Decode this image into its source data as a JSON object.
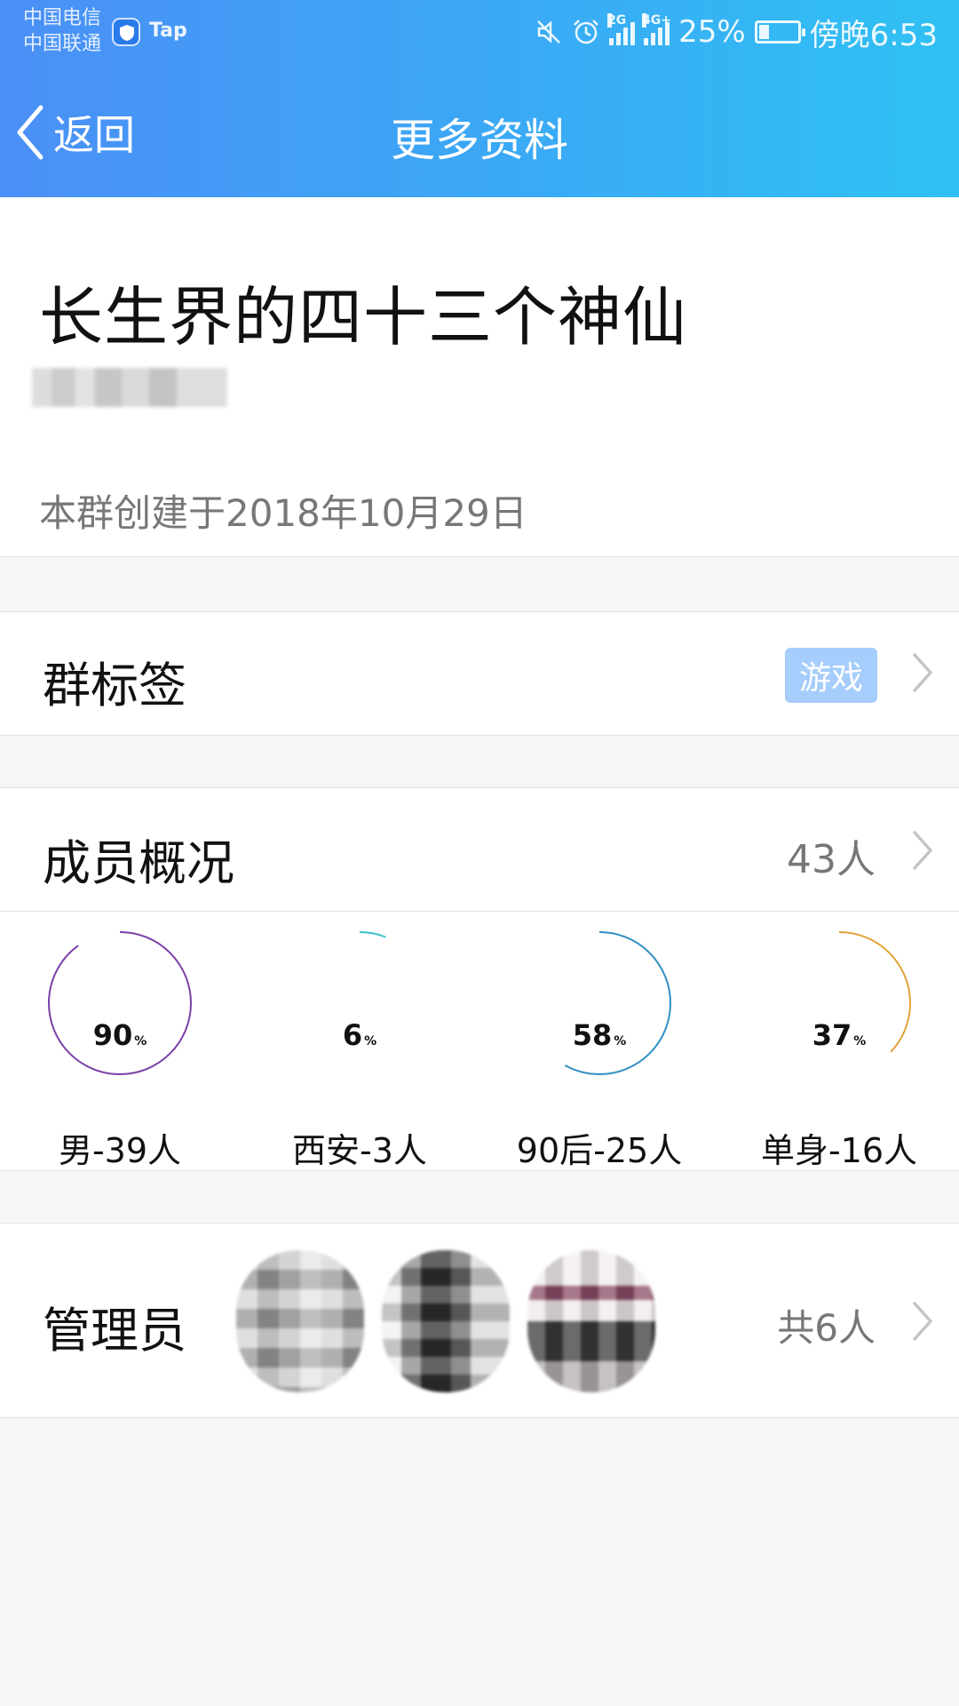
{
  "status_bar": {
    "carrier_1": "中国电信",
    "carrier_2": "中国联通",
    "app_badge": "Tap",
    "network_1": "2G",
    "network_2": "4G+",
    "battery": "25%",
    "time": "傍晚6:53"
  },
  "nav": {
    "back_label": "返回",
    "title": "更多资料"
  },
  "group": {
    "name": "长生界的四十三个神仙",
    "created": "本群创建于2018年10月29日"
  },
  "tags": {
    "label": "群标签",
    "value": "游戏"
  },
  "members": {
    "label": "成员概况",
    "count": "43人",
    "stats": [
      {
        "percent": 90,
        "percent_text": "90",
        "unit": "%",
        "label": "男-39人",
        "color": "#7b3fa8"
      },
      {
        "percent": 6,
        "percent_text": "6",
        "unit": "%",
        "label": "西安-3人",
        "color": "#35c1c6"
      },
      {
        "percent": 58,
        "percent_text": "58",
        "unit": "%",
        "label": "90后-25人",
        "color": "#2f8fc4"
      },
      {
        "percent": 37,
        "percent_text": "37",
        "unit": "%",
        "label": "单身-16人",
        "color": "#e3a23a"
      }
    ]
  },
  "admins": {
    "label": "管理员",
    "count": "共6人"
  },
  "colors": {
    "header_start": "#4b8ff6",
    "header_end": "#2fc1f3",
    "tag_badge": "#a6cdfb"
  }
}
